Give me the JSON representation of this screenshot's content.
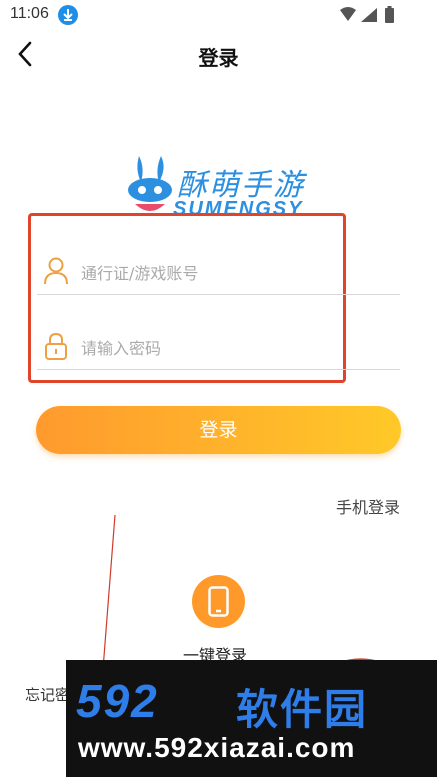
{
  "status_bar": {
    "time": "11:06"
  },
  "nav": {
    "title": "登录"
  },
  "logo": {
    "cn": "酥萌手游",
    "en": "SUMENGSY"
  },
  "form": {
    "account_placeholder": "通行证/游戏账号",
    "password_placeholder": "请输入密码",
    "login_label": "登录"
  },
  "links": {
    "phone_login": "手机登录",
    "one_key_login": "一键登录",
    "forgot": "忘记密码"
  },
  "watermark": {
    "brand_num": "592",
    "brand_cn": "软件园",
    "url": "www.592xiazai.com"
  },
  "colors": {
    "accent": "#ff9a2e",
    "accent_end": "#ffc928",
    "highlight": "#e0452b",
    "logo": "#2c8fe0"
  },
  "icons": [
    "download-icon",
    "wifi-icon",
    "signal-icon",
    "battery-icon",
    "back-chevron-icon",
    "user-icon",
    "lock-icon",
    "phone-icon"
  ]
}
